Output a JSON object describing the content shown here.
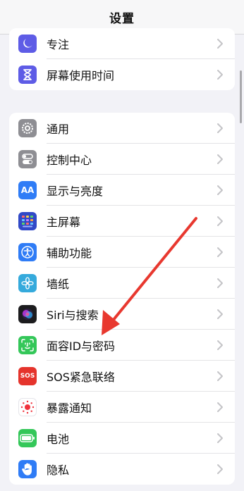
{
  "navbar": {
    "title": "设置"
  },
  "groups": [
    {
      "items": [
        {
          "label": "专注",
          "icon": "moon-icon",
          "color": "#5e5ce6"
        },
        {
          "label": "屏幕使用时间",
          "icon": "hourglass-icon",
          "color": "#5e5ce6"
        }
      ]
    },
    {
      "items": [
        {
          "label": "通用",
          "icon": "gear-icon",
          "color": "#8e8e93"
        },
        {
          "label": "控制中心",
          "icon": "toggles-icon",
          "color": "#8e8e93"
        },
        {
          "label": "显示与亮度",
          "icon": "text-size-icon",
          "text": "AA",
          "color": "#2f7cf6"
        },
        {
          "label": "主屏幕",
          "icon": "home-grid-icon",
          "color": "#3149c7"
        },
        {
          "label": "辅助功能",
          "icon": "accessibility-icon",
          "color": "#2f7cf6"
        },
        {
          "label": "墙纸",
          "icon": "flower-icon",
          "color": "#35aadc"
        },
        {
          "label": "Siri与搜索",
          "icon": "siri-icon",
          "color": "#1c1c1e"
        },
        {
          "label": "面容ID与密码",
          "icon": "face-id-icon",
          "color": "#34c759"
        },
        {
          "label": "SOS紧急联络",
          "icon": "sos-icon",
          "text": "SOS",
          "color": "#e5342c"
        },
        {
          "label": "暴露通知",
          "icon": "exposure-icon",
          "color": "#ffffff"
        },
        {
          "label": "电池",
          "icon": "battery-icon",
          "color": "#34c759"
        },
        {
          "label": "隐私",
          "icon": "hand-icon",
          "color": "#2f7cf6"
        }
      ]
    }
  ],
  "colors": {
    "background": "#f2f2f7",
    "annotation_arrow": "#e8382f"
  }
}
